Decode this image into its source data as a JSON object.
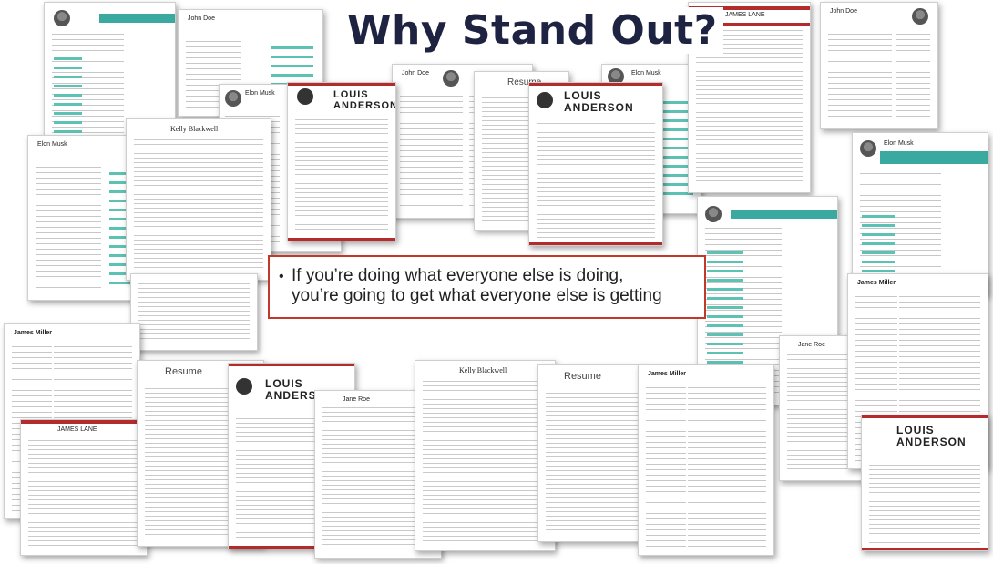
{
  "title": "Why Stand Out?",
  "quote": {
    "line1": "If you’re doing what everyone else is doing,",
    "line2": "you’re going to get what everyone else is getting"
  },
  "colors": {
    "title": "#1d2340",
    "box_border": "#c0392b",
    "accent_teal": "#3aa9a0",
    "accent_red": "#b32b2b"
  },
  "resumes": {
    "r01": "Elon Musk",
    "r02": "John Doe",
    "r03": "Elon Musk",
    "r04": "LOUIS ANDERSON",
    "r05": "John Doe",
    "r06": "Resume",
    "r07": "LOUIS ANDERSON",
    "r08": "JAMES LANE",
    "r09": "John Doe",
    "r10": "Elon Musk",
    "r11": "Kelly Blackwell",
    "r12": "Elon Musk",
    "r13": "Elon Musk",
    "r14": "James Miller",
    "r15": "JAMES LANE",
    "r16": "Resume",
    "r17": "LOUIS ANDERSON",
    "r18": "Jane Roe",
    "r19": "Kelly Blackwell",
    "r20": "Resume",
    "r21": "James Miller",
    "r22": "Jane Roe",
    "r23": "LOUIS ANDERSON",
    "r24": "James Miller",
    "r25": "Elon Musk"
  }
}
